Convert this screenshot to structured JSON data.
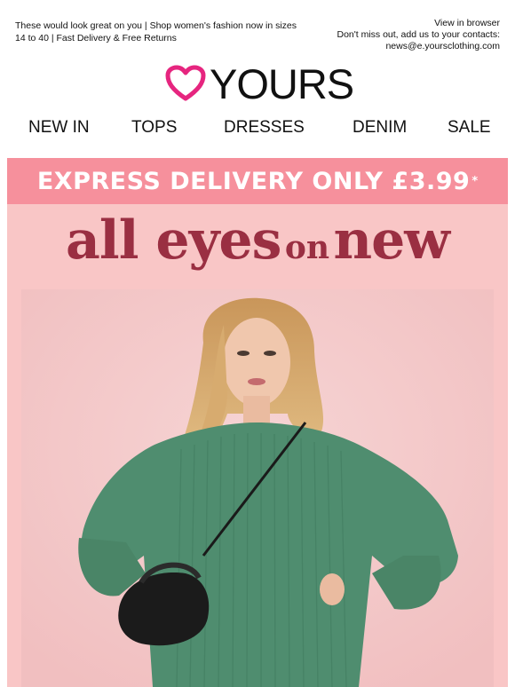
{
  "preheader": {
    "text": "These would look great on you | Shop women's fashion now in sizes 14 to 40 | Fast Delivery & Free Returns"
  },
  "header_links": {
    "view_in_browser": "View in browser",
    "dont_miss": "Don't miss out, add us to your contacts:",
    "email": "news@e.yoursclothing.com"
  },
  "logo": {
    "text": "YOURS",
    "icon": "heart-icon",
    "accent_color": "#e6257f"
  },
  "nav": {
    "items": [
      {
        "label": "NEW IN"
      },
      {
        "label": "TOPS"
      },
      {
        "label": "DRESSES"
      },
      {
        "label": "DENIM"
      },
      {
        "label": "SALE"
      }
    ]
  },
  "banner": {
    "text": "EXPRESS DELIVERY ONLY £3.99",
    "asterisk": "*",
    "bg_color": "#f6909c"
  },
  "hero": {
    "headline_part1": "all eyes",
    "headline_part2": "on",
    "headline_part3": "new",
    "headline_color": "#9a2f42",
    "bg_color": "#f9c6c6"
  }
}
